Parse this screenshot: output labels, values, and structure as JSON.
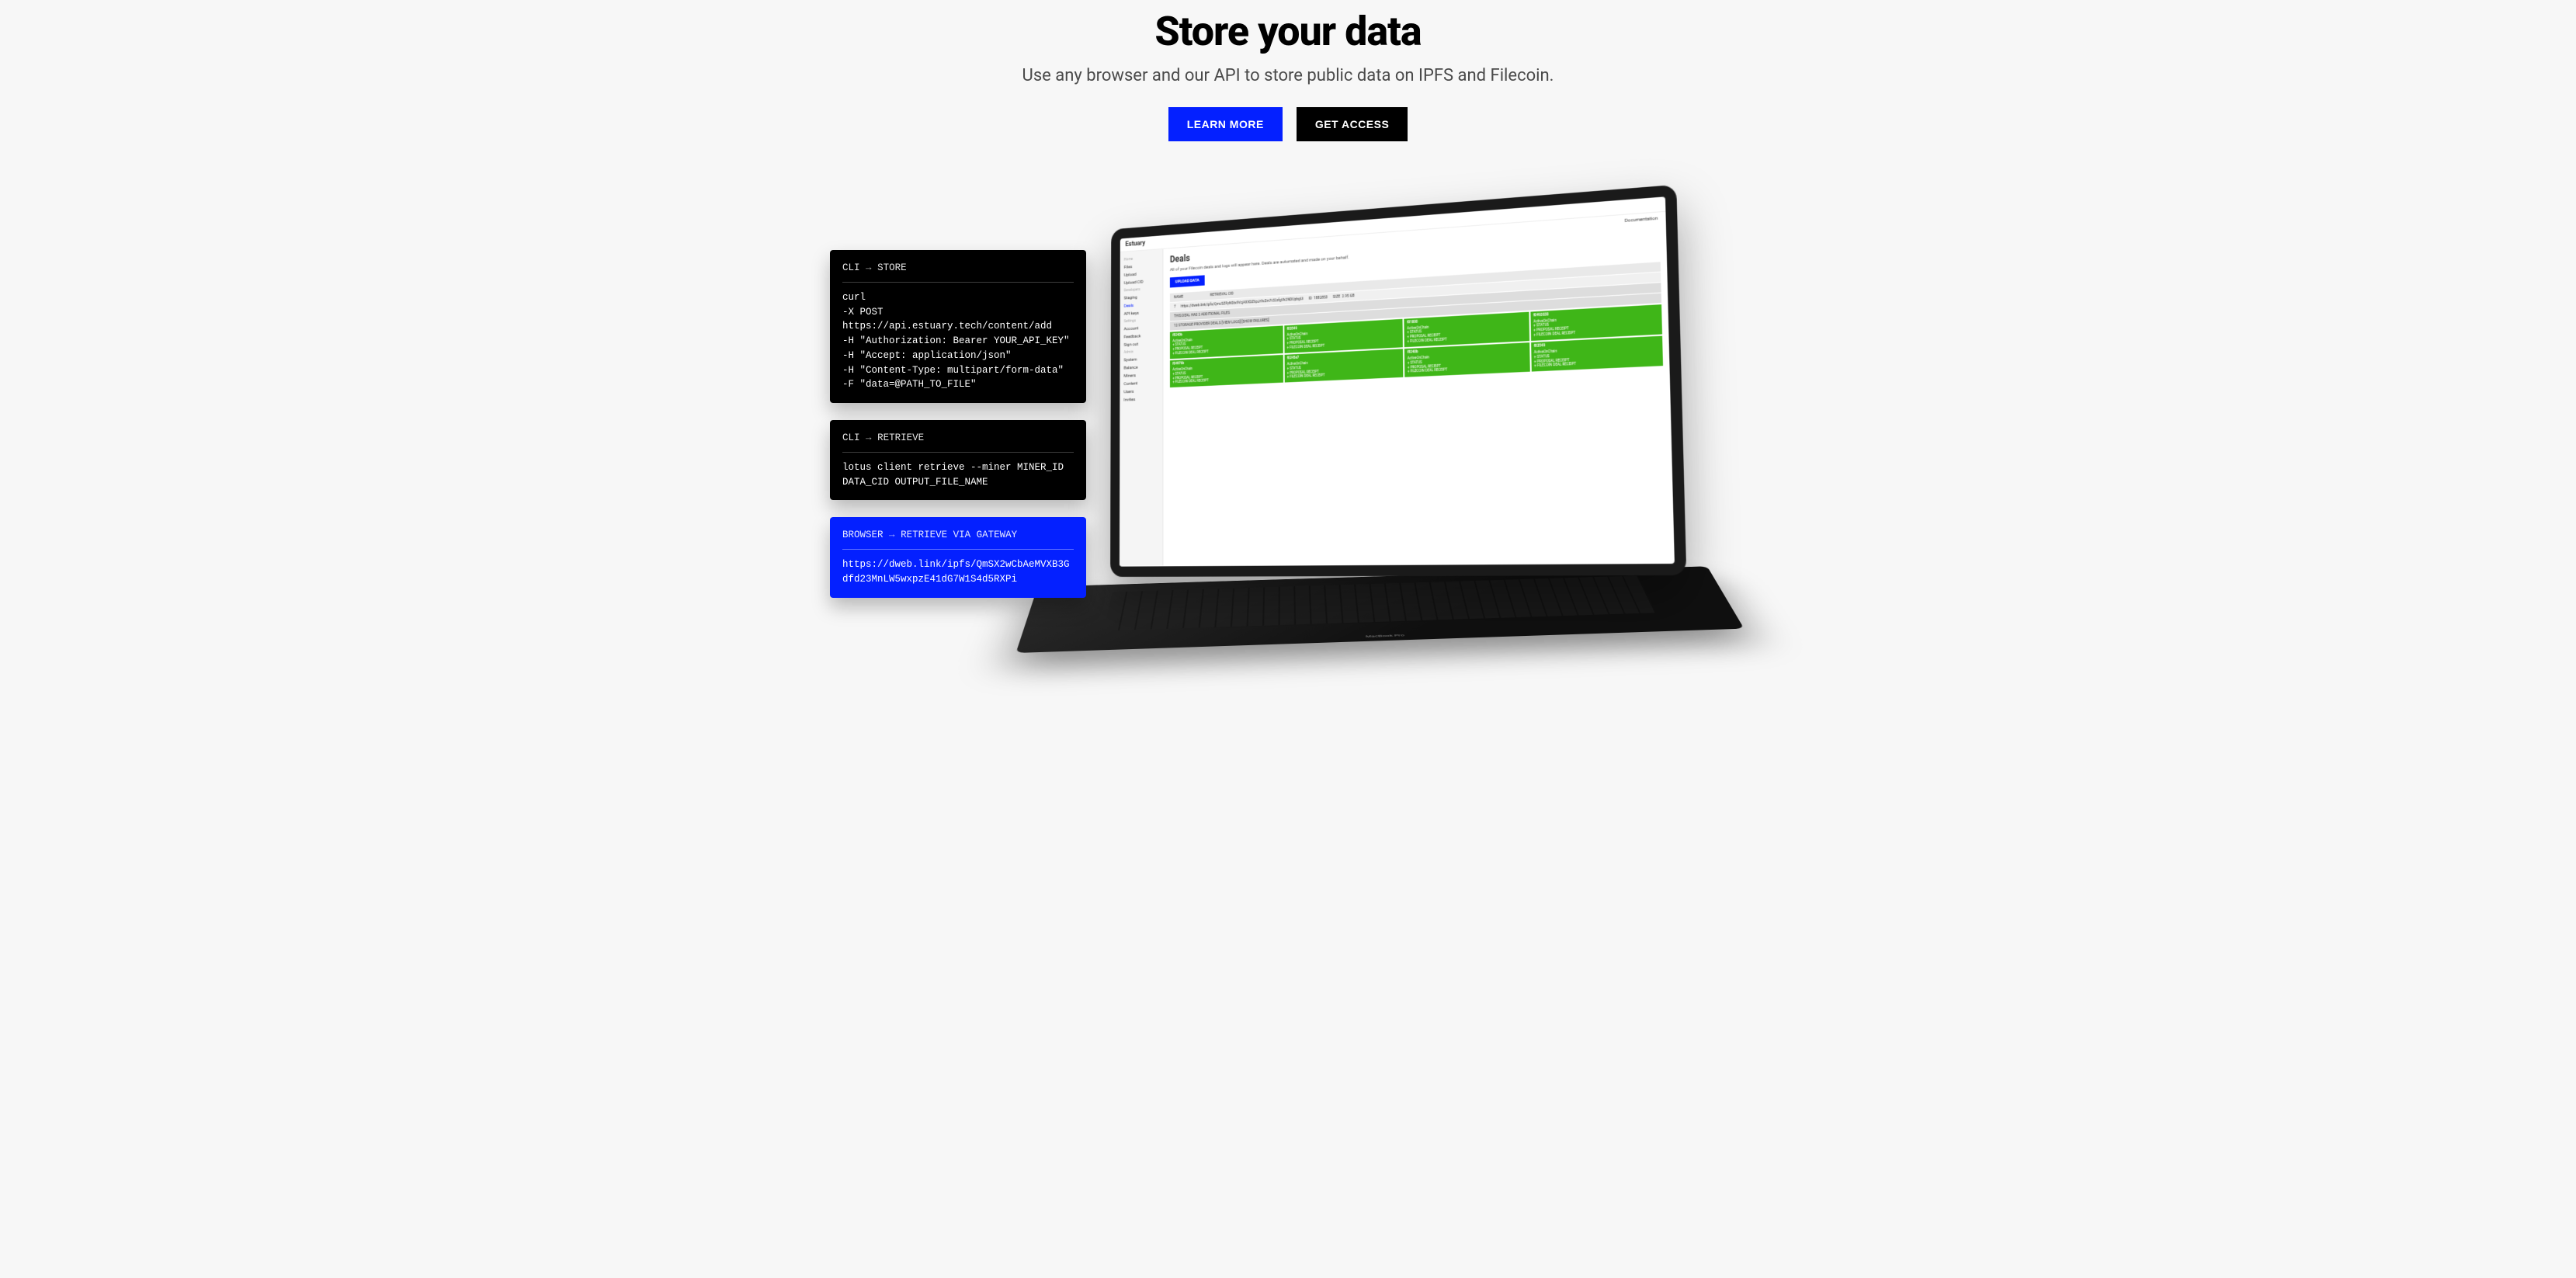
{
  "hero": {
    "title": "Store your data",
    "subtitle": "Use any browser and our API to store public data on IPFS and Filecoin.",
    "learn_more": "LEARN MORE",
    "get_access": "GET ACCESS"
  },
  "cards": {
    "store": {
      "title_prefix": "CLI",
      "arrow": "→",
      "title_suffix": "STORE",
      "body": "curl\n-X POST\nhttps://api.estuary.tech/content/add\n-H \"Authorization: Bearer YOUR_API_KEY\"\n-H \"Accept: application/json\"\n-H \"Content-Type: multipart/form-data\"\n-F \"data=@PATH_TO_FILE\""
    },
    "retrieve": {
      "title_prefix": "CLI",
      "arrow": "→",
      "title_suffix": "RETRIEVE",
      "body": "lotus client retrieve --miner MINER_ID DATA_CID OUTPUT_FILE_NAME"
    },
    "gateway": {
      "title_prefix": "BROWSER",
      "arrow": "→",
      "title_suffix": "RETRIEVE VIA GATEWAY",
      "body": "https://dweb.link/ipfs/QmSX2wCbAeMVXB3Gdfd23MnLW5wxpzE41dG7W1S4d5RXPi"
    }
  },
  "laptop": {
    "brand": "MacBook Pro",
    "app_name": "Estuary",
    "doc_link": "Documentation",
    "sidebar": {
      "groups": [
        {
          "label": "Home",
          "items": [
            "Files",
            "Upload",
            "Upload CID"
          ]
        },
        {
          "label": "Developers",
          "items": [
            "Staging",
            "Deals",
            "API keys"
          ]
        },
        {
          "label": "Settings",
          "items": [
            "Account",
            "Feedback",
            "Sign out"
          ]
        },
        {
          "label": "Admin",
          "items": [
            "System",
            "Balance",
            "Miners",
            "Content",
            "Users",
            "Invites"
          ]
        }
      ],
      "active": "Deals"
    },
    "content": {
      "heading": "Deals",
      "desc": "All of your Filecoin deals and logs will appear here. Deals are automated and made on your behalf.",
      "upload_label": "UPLOAD DATA",
      "row_header": {
        "name_label": "NAME",
        "retrieval_label": "RETRIEVAL CID",
        "id_label": "ID",
        "size_label": "SIZE"
      },
      "row": {
        "name": "7",
        "cid": "https://dweb.link/ipfs/QmcSZPyNStx9VcjAXXDZ6pJr9vZm7r32zfgVk2NDUpbgUi",
        "id": "1882853",
        "size": "2.95 GB"
      },
      "note": "THIS DEAL HAS 2 ADDITIONAL FILES",
      "subnote": "12 STORAGE PROVIDER DEALS [VIEW LOGS] [SHOW FAILURES]",
      "miners": [
        "f8240b",
        "f83549",
        "f01000",
        "f0492030",
        "f04976b",
        "f0245e7"
      ],
      "cell_lines": [
        "ActiveOnChain",
        "+ STATUS",
        "+ PROPOSAL RECEIPT",
        "+ FILECOIN DEAL RECEIPT"
      ]
    }
  }
}
